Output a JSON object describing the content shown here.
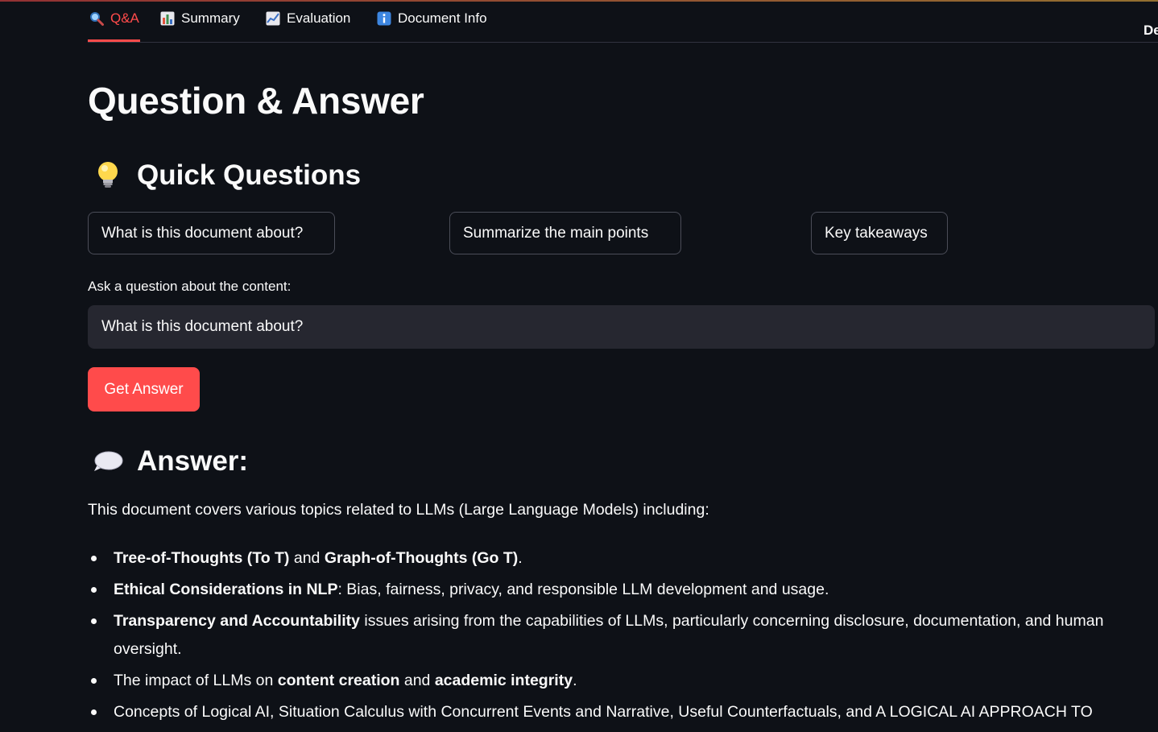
{
  "colors": {
    "background": "#0e1117",
    "accent": "#ff4b4b",
    "input_background": "#262730",
    "text": "#fafafa"
  },
  "tabs": [
    {
      "label": "Q&A",
      "icon": "magnifier-icon",
      "active": true
    },
    {
      "label": "Summary",
      "icon": "bar-chart-icon",
      "active": false
    },
    {
      "label": "Evaluation",
      "icon": "line-chart-icon",
      "active": false
    },
    {
      "label": "Document Info",
      "icon": "info-icon",
      "active": false
    }
  ],
  "header": {
    "deploy_label": "Deploy"
  },
  "page": {
    "title": "Question & Answer"
  },
  "quick_questions": {
    "heading": "Quick Questions",
    "icon": "lightbulb-icon",
    "buttons": [
      "What is this document about?",
      "Summarize the main points",
      "Key takeaways"
    ]
  },
  "ask": {
    "label": "Ask a question about the content:",
    "value": "What is this document about?",
    "button_label": "Get Answer"
  },
  "answer": {
    "heading": "Answer:",
    "icon": "speech-bubble-icon",
    "intro": "This document covers various topics related to LLMs (Large Language Models) including:",
    "items": [
      {
        "b1": "Tree-of-Thoughts (To T)",
        "t1": " and ",
        "b2": "Graph-of-Thoughts (Go T)",
        "t2": "."
      },
      {
        "b1": "Ethical Considerations in NLP",
        "t1": ": Bias, fairness, privacy, and responsible LLM development and usage."
      },
      {
        "b1": "Transparency and Accountability",
        "t1": " issues arising from the capabilities of LLMs, particularly concerning disclosure, documentation, and human oversight."
      },
      {
        "t0": "The impact of LLMs on ",
        "b1": "content creation",
        "t1": " and ",
        "b2": "academic integrity",
        "t2": "."
      },
      {
        "t0": "Concepts of Logical AI, Situation Calculus with Concurrent Events and Narrative, Useful Counterfactuals, and A LOGICAL AI APPROACH TO"
      }
    ]
  }
}
